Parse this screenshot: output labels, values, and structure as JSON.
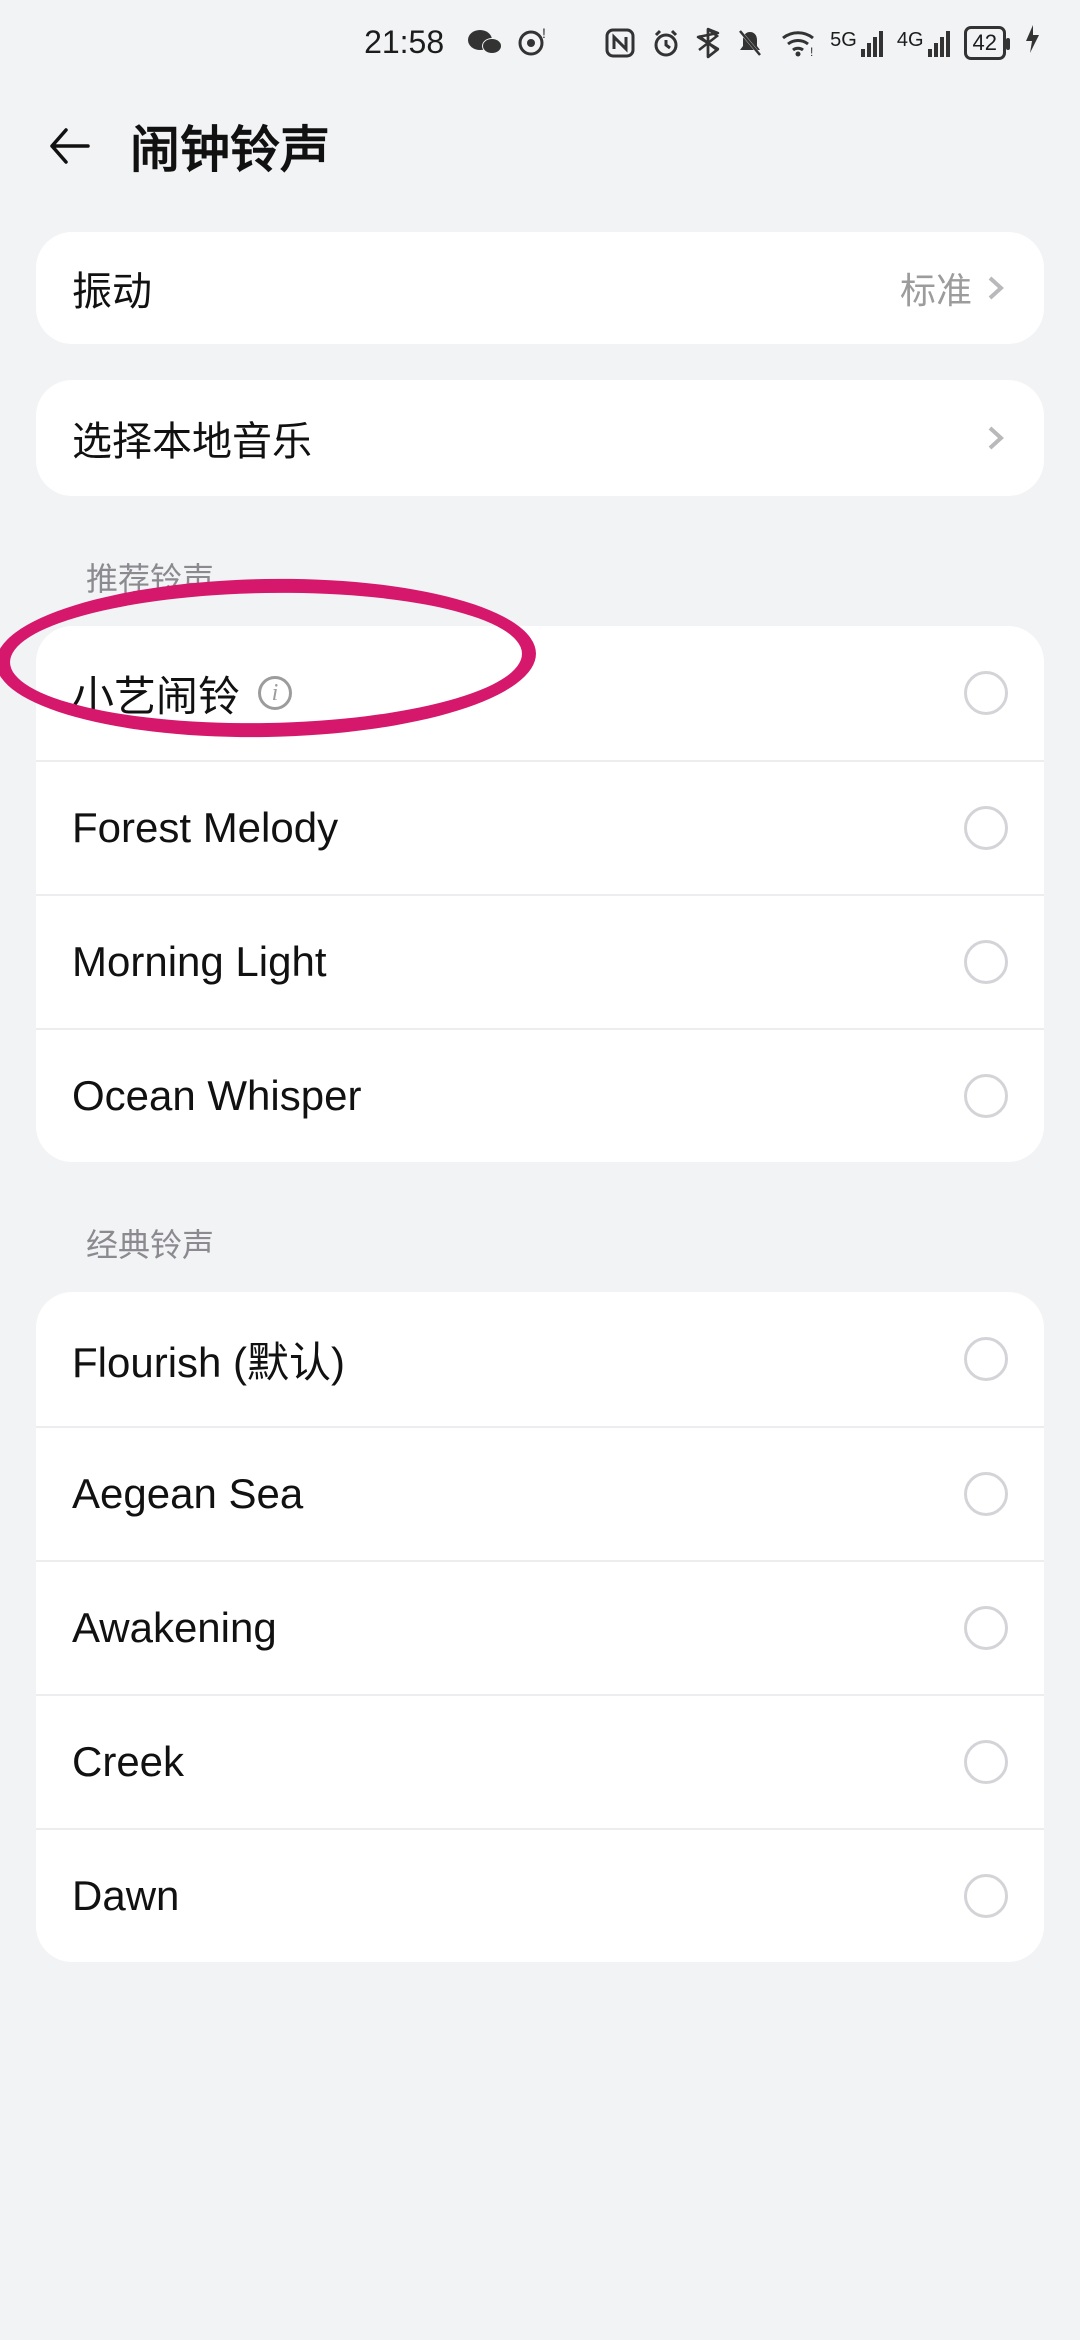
{
  "status": {
    "time": "21:58",
    "net5g": "5G",
    "net4g": "4G",
    "battery": "42"
  },
  "header": {
    "title": "闹钟铃声"
  },
  "vibration": {
    "label": "振动",
    "value": "标准"
  },
  "localMusic": {
    "label": "选择本地音乐"
  },
  "sections": {
    "recommended": {
      "title": "推荐铃声",
      "items": [
        {
          "label": "小艺闹铃",
          "info": true
        },
        {
          "label": "Forest Melody"
        },
        {
          "label": "Morning Light"
        },
        {
          "label": "Ocean Whisper"
        }
      ]
    },
    "classic": {
      "title": "经典铃声",
      "items": [
        {
          "label": "Flourish (默认)"
        },
        {
          "label": "Aegean Sea"
        },
        {
          "label": "Awakening"
        },
        {
          "label": "Creek"
        },
        {
          "label": "Dawn"
        }
      ]
    }
  }
}
